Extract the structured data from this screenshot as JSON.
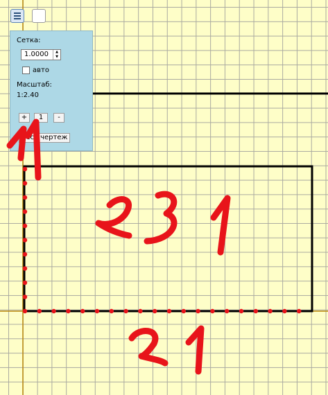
{
  "panel": {
    "grid_label": "Сетка:",
    "grid_value": "1.0000",
    "auto_label": "авто",
    "scale_label": "Масштаб:",
    "scale_value": "1:2.40",
    "zoom_in_label": "+",
    "zoom_reset_label": "1",
    "zoom_out_label": "-",
    "whole_drawing_label": "Весь чертеж"
  },
  "annotations": {
    "left_mark": "11",
    "inside_mark": "231",
    "bottom_mark": "21"
  },
  "colors": {
    "paper": "#fefec8",
    "grid": "#a9a9a0",
    "axis": "#b8860b",
    "drawing": "#000000",
    "annotation": "#e8141a",
    "panel": "#add8e6"
  }
}
